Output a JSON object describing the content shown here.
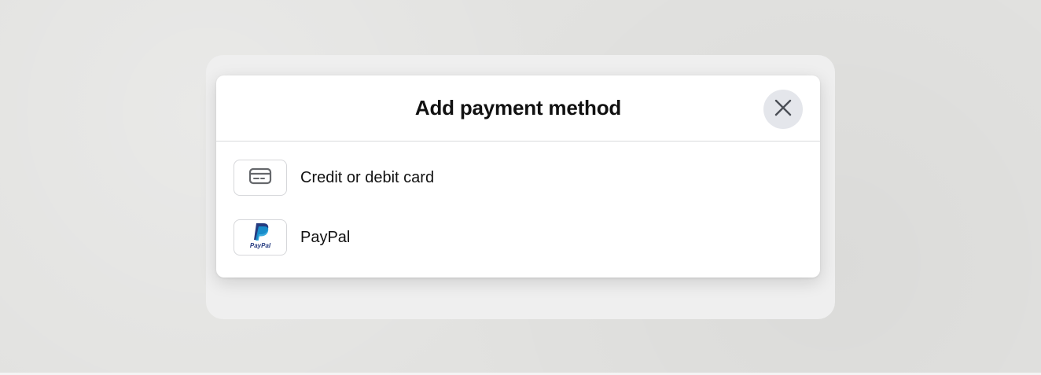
{
  "dialog": {
    "title": "Add payment method",
    "close_icon": "close-icon"
  },
  "options": [
    {
      "label": "Credit or debit card",
      "icon": "credit-card-icon"
    },
    {
      "label": "PayPal",
      "icon": "paypal-logo-icon",
      "logo_text": "PayPal",
      "logo_colors": [
        "#253b80",
        "#179bd7"
      ]
    }
  ]
}
